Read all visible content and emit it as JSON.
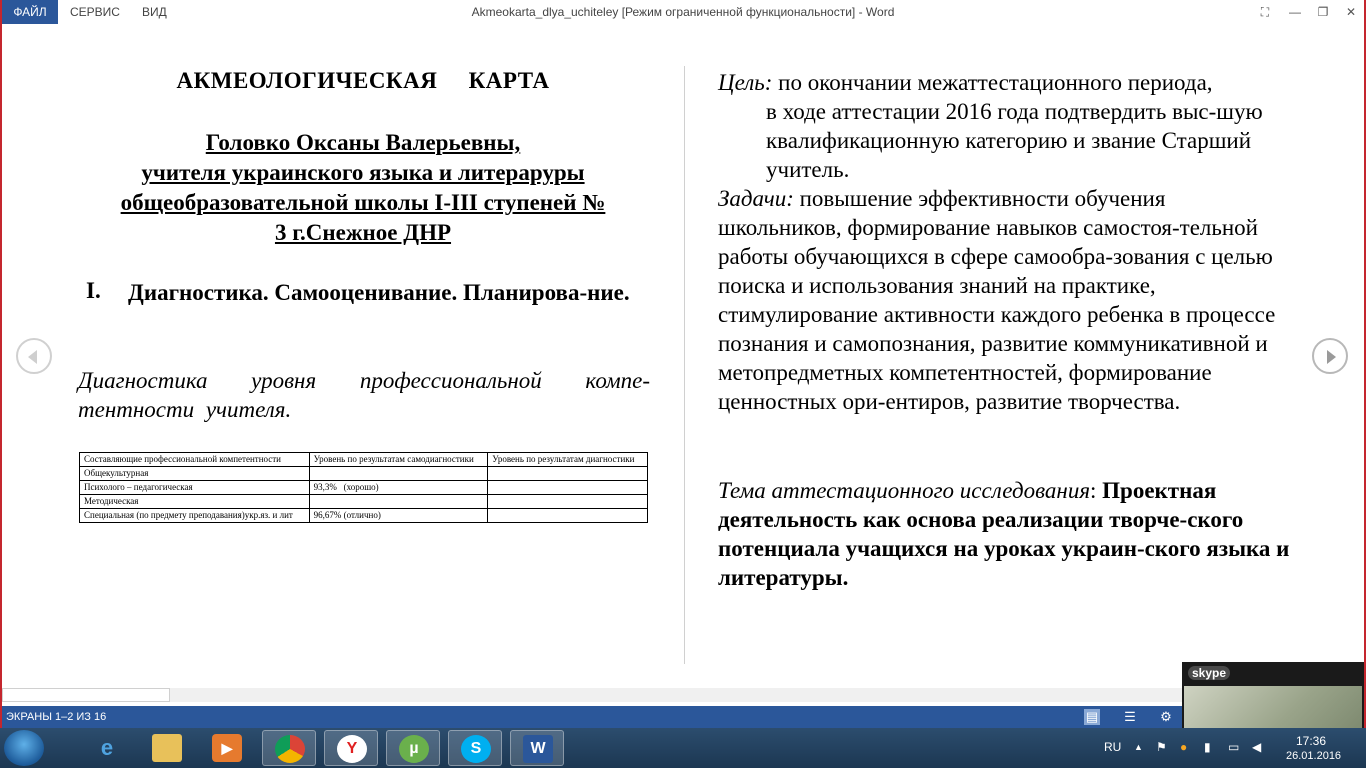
{
  "menu": {
    "file": "ФАЙЛ",
    "service": "СЕРВИС",
    "view": "ВИД"
  },
  "window": {
    "title": "Akmeokarta_dlya_uchiteley [Режим ограниченной функциональности] - Word"
  },
  "left_page": {
    "title": "АКМЕОЛОГИЧЕСКАЯ     КАРТА",
    "author_lines": [
      "Головко Оксаны Валерьевны,",
      "учителя украинского языка и литераруры",
      "общеобразовательной школы І-ІІІ ступеней №",
      "3 г.Снежное ДНР"
    ],
    "section_number": "I.",
    "section_title": "Диагностика. Самооценивание. Планирова-ние.",
    "diagnostics_caption": "Диагностика уровня профессиональной компе-тентности учителя.",
    "table": {
      "headers": [
        "Составляющие профессиональной компетентности",
        "Уровень по результатам самодиагностики",
        "Уровень по результатам диагностики"
      ],
      "rows": [
        [
          "Общекультурная",
          "",
          ""
        ],
        [
          "Психолого – педагогическая",
          "93,3%   (хорошо)",
          ""
        ],
        [
          "Методическая",
          "",
          ""
        ],
        [
          "Специальная (по предмету преподавания)укр.яз. и лит",
          "96,67% (отлично)",
          ""
        ]
      ]
    }
  },
  "right_page": {
    "goal_label": "Цель:",
    "goal_first": "по окончании межаттестационного периода,",
    "goal_rest": "в ходе аттестации 2016 года подтвердить выс-шую квалификационную категорию и звание Старший учитель.",
    "tasks_label": "Задачи:",
    "tasks_text": "повышение эффективности обучения школьников, формирование навыков самостоя-тельной работы обучающихся в сфере самообра-зования с целью поиска  и использования знаний на практике, стимулирование активности каждого ребенка в процессе познания и  самопознания, развитие коммуникативной  и метопредметных компетентностей, формирование ценностных ори-ентиров, развитие творчества.",
    "topic_label": "Тема аттестационного исследования",
    "topic_colon": ": ",
    "topic_text": "Проектная деятельность как основа реализации творче-ского потенциала учащихся на уроках украин-ского языка и литературы."
  },
  "status": {
    "pages": "ЭКРАНЫ 1–2 ИЗ 16"
  },
  "skype": {
    "label": "skype"
  },
  "tray": {
    "language": "RU",
    "time": "17:36",
    "date": "26.01.2016"
  },
  "taskbar": {
    "apps": [
      "start-button",
      "internet-explorer-icon",
      "file-explorer-icon",
      "media-player-icon",
      "chrome-icon",
      "yandex-browser-icon",
      "utorrent-icon",
      "skype-icon",
      "word-icon"
    ]
  }
}
